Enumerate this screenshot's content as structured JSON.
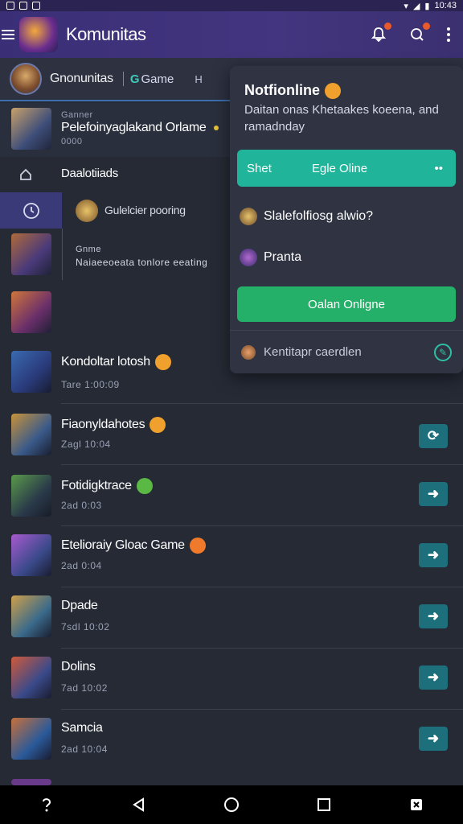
{
  "status_bar": {
    "time": "10:43"
  },
  "app_bar": {
    "title": "Komunitas"
  },
  "tabs": {
    "community": "Gnonunitas",
    "game": "Game",
    "game_glyph": "G",
    "extra": "H"
  },
  "feature": {
    "label": "Ganner",
    "title": "Pelefoinyaglakand Orlame",
    "sub": "0000"
  },
  "home_nav": {
    "label": "Daalotiiads"
  },
  "activity": {
    "label": "Gulelcier pooring"
  },
  "game_row": {
    "label": "Gnme",
    "text": "Naiaeeoeata tonlore eeating"
  },
  "rows": [
    {
      "title": "Kondoltar lotosh",
      "sub": "Tare 1:00:09",
      "emoji_color": "#f0a02c"
    },
    {
      "title": "Fiaonyldahotes",
      "sub": "Zagl 10:04",
      "emoji_color": "#f0a02c"
    },
    {
      "title": "Fotidigktrace",
      "sub": "2ad 0:03",
      "emoji_color": "#5ab845"
    },
    {
      "title": "Etelioraiy Gloac Game",
      "sub": "2ad 0:04",
      "emoji_color": "#f07a2c"
    },
    {
      "title": "Dpade",
      "sub": "7sdl 10:02",
      "emoji_color": ""
    },
    {
      "title": "Dolins",
      "sub": "7ad 10:02",
      "emoji_color": ""
    },
    {
      "title": "Samcia",
      "sub": "2ad 10:04",
      "emoji_color": ""
    }
  ],
  "popup": {
    "title": "Notfionline",
    "description": "Daitan onas Khetaakes koeena, and ramadnday",
    "bar_left": "Shet",
    "bar_center": "Egle Oline",
    "bar_right": "••",
    "item1": "Slalefolfiosg alwio?",
    "item2": "Pranta",
    "cta": "Oalan Onligne",
    "footer": "Kentitapr caerdlen"
  },
  "colors": {
    "accent_teal": "#20b59a",
    "accent_green": "#25b06a",
    "appbar_purple": "#3a2f77"
  }
}
